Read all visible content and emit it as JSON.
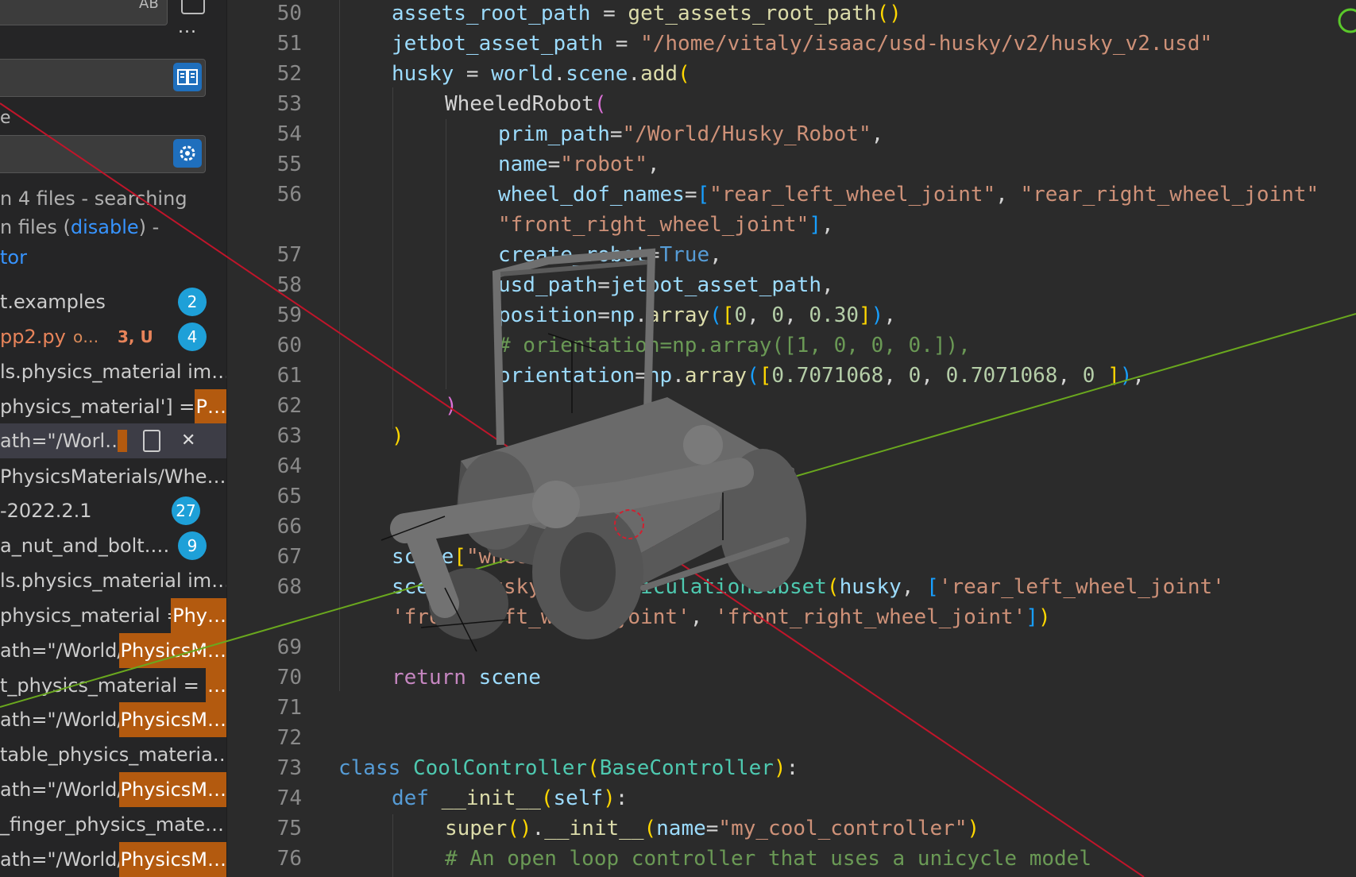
{
  "sidebar": {
    "search_case_label": "AB",
    "more_label": "...",
    "status_line1": "n 4 files - searching",
    "status_line2_prefix": "n files (",
    "status_line2_link": "disable",
    "status_line2_suffix": ") -",
    "status_line3": "tor",
    "results": [
      {
        "text": "t.examples",
        "badge": "2"
      },
      {
        "text": "pp2.py",
        "meta": "o…",
        "status": "3, U",
        "badge": "4"
      },
      {
        "text": "ls.physics_material im…"
      },
      {
        "text": "physics_material'] = ",
        "highlight": "P…"
      },
      {
        "text": "ath=\"/Worl…",
        "selected": true
      },
      {
        "text": "PhysicsMaterials/Whe…"
      },
      {
        "text": "-2022.2.1",
        "badge": "27"
      },
      {
        "text": "a_nut_and_bolt.…",
        "badge": "9"
      },
      {
        "text": "ls.physics_material im…"
      },
      {
        "text": "physics_material = ",
        "highlight": "Phy…"
      },
      {
        "text": "ath=\"/World/",
        "highlight": "PhysicsM…"
      },
      {
        "text": "t_physics_material = ",
        "highlight": "…"
      },
      {
        "text": "ath=\"/World/",
        "highlight": "PhysicsM…"
      },
      {
        "text": "table_physics_materia…"
      },
      {
        "text": "ath=\"/World/",
        "highlight": "PhysicsM…"
      },
      {
        "text": "_finger_physics_mate…"
      },
      {
        "text": "ath=\"/World/",
        "highlight": "PhysicsM…"
      }
    ]
  },
  "editor": {
    "line_numbers": [
      "50",
      "51",
      "52",
      "53",
      "54",
      "55",
      "56",
      "57",
      "58",
      "59",
      "60",
      "61",
      "62",
      "63",
      "64",
      "65",
      "66",
      "67",
      "68",
      "69",
      "70",
      "71",
      "72",
      "73",
      "74",
      "75",
      "76"
    ]
  },
  "colors": {
    "x_axis": "#c0152a",
    "y_axis": "#6aa81e",
    "accent": "#1ea0d8",
    "highlight": "#b35a0f"
  }
}
